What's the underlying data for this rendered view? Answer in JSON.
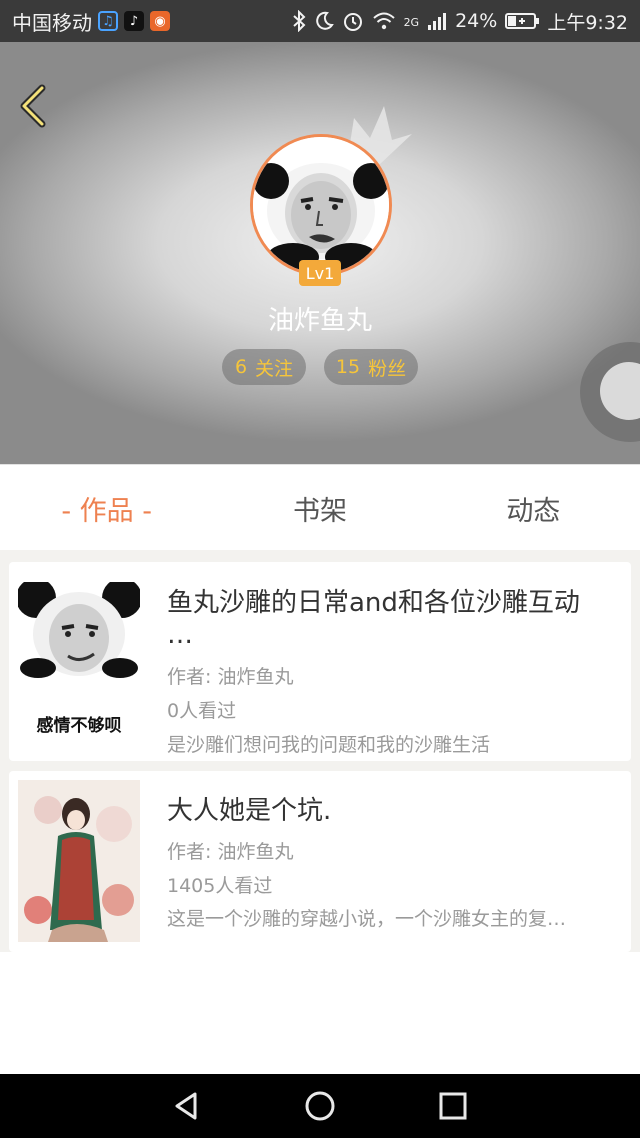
{
  "status_bar": {
    "carrier": "中国移动",
    "network": "2G",
    "battery": "24%",
    "time": "上午9:32",
    "icons": [
      "headset-app-icon",
      "tiktok-app-icon",
      "orange-app-icon",
      "bluetooth-icon",
      "moon-icon",
      "alarm-icon",
      "wifi-icon",
      "signal-icon",
      "battery-icon"
    ]
  },
  "profile": {
    "level": "Lv1",
    "nickname": "油炸鱼丸",
    "following_count": "6",
    "following_label": "关注",
    "fans_count": "15",
    "fans_label": "粉丝"
  },
  "tabs": [
    {
      "label": "- 作品 -",
      "active": true
    },
    {
      "label": "书架",
      "active": false
    },
    {
      "label": "动态",
      "active": false
    }
  ],
  "works": [
    {
      "title": "鱼丸沙雕的日常and和各位沙雕互动\n…",
      "author": "作者: 油炸鱼丸",
      "views": "0人看过",
      "description": "是沙雕们想问我的问题和我的沙雕生活",
      "cover_caption": "感情不够呗"
    },
    {
      "title": "大人她是个坑.",
      "author": "作者: 油炸鱼丸",
      "views": "1405人看过",
      "description": "这是一个沙雕的穿越小说，一个沙雕女主的复…"
    }
  ],
  "colors": {
    "accent": "#ee8150",
    "stat_text": "#f6c53a",
    "level_badge": "#f3a93a"
  }
}
